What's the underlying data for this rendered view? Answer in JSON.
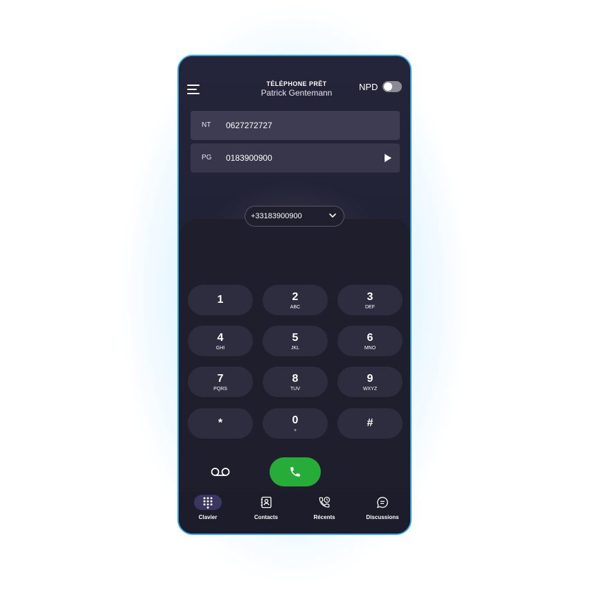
{
  "header": {
    "status_title": "TÉLÉPHONE PRÊT",
    "user_name": "Patrick Gentemann",
    "npd_label": "NPD",
    "npd_enabled": false
  },
  "lines": [
    {
      "code": "NT",
      "number": "0627272727"
    },
    {
      "code": "PG",
      "number": "0183900900"
    }
  ],
  "caller_id": {
    "selected": "+33183900900"
  },
  "keypad": [
    {
      "digit": "1",
      "letters": ""
    },
    {
      "digit": "2",
      "letters": "ABC"
    },
    {
      "digit": "3",
      "letters": "DEF"
    },
    {
      "digit": "4",
      "letters": "GHI"
    },
    {
      "digit": "5",
      "letters": "JKL"
    },
    {
      "digit": "6",
      "letters": "MNO"
    },
    {
      "digit": "7",
      "letters": "PQRS"
    },
    {
      "digit": "8",
      "letters": "TUV"
    },
    {
      "digit": "9",
      "letters": "WXYZ"
    },
    {
      "digit": "*",
      "letters": ""
    },
    {
      "digit": "0",
      "letters": "+"
    },
    {
      "digit": "#",
      "letters": ""
    }
  ],
  "actions": {
    "voicemail_icon": "voicemail-icon",
    "call_icon": "phone-icon",
    "call_color": "#27ac3a"
  },
  "nav": [
    {
      "label": "Clavier",
      "icon": "dialpad-icon",
      "active": true
    },
    {
      "label": "Contacts",
      "icon": "contacts-icon",
      "active": false
    },
    {
      "label": "Récents",
      "icon": "recent-calls-icon",
      "active": false
    },
    {
      "label": "Discussions",
      "icon": "chat-icon",
      "active": false
    }
  ],
  "colors": {
    "accent_border": "#3aa7e6",
    "background": "#1f1f2e",
    "active_nav": "#3b3560"
  }
}
